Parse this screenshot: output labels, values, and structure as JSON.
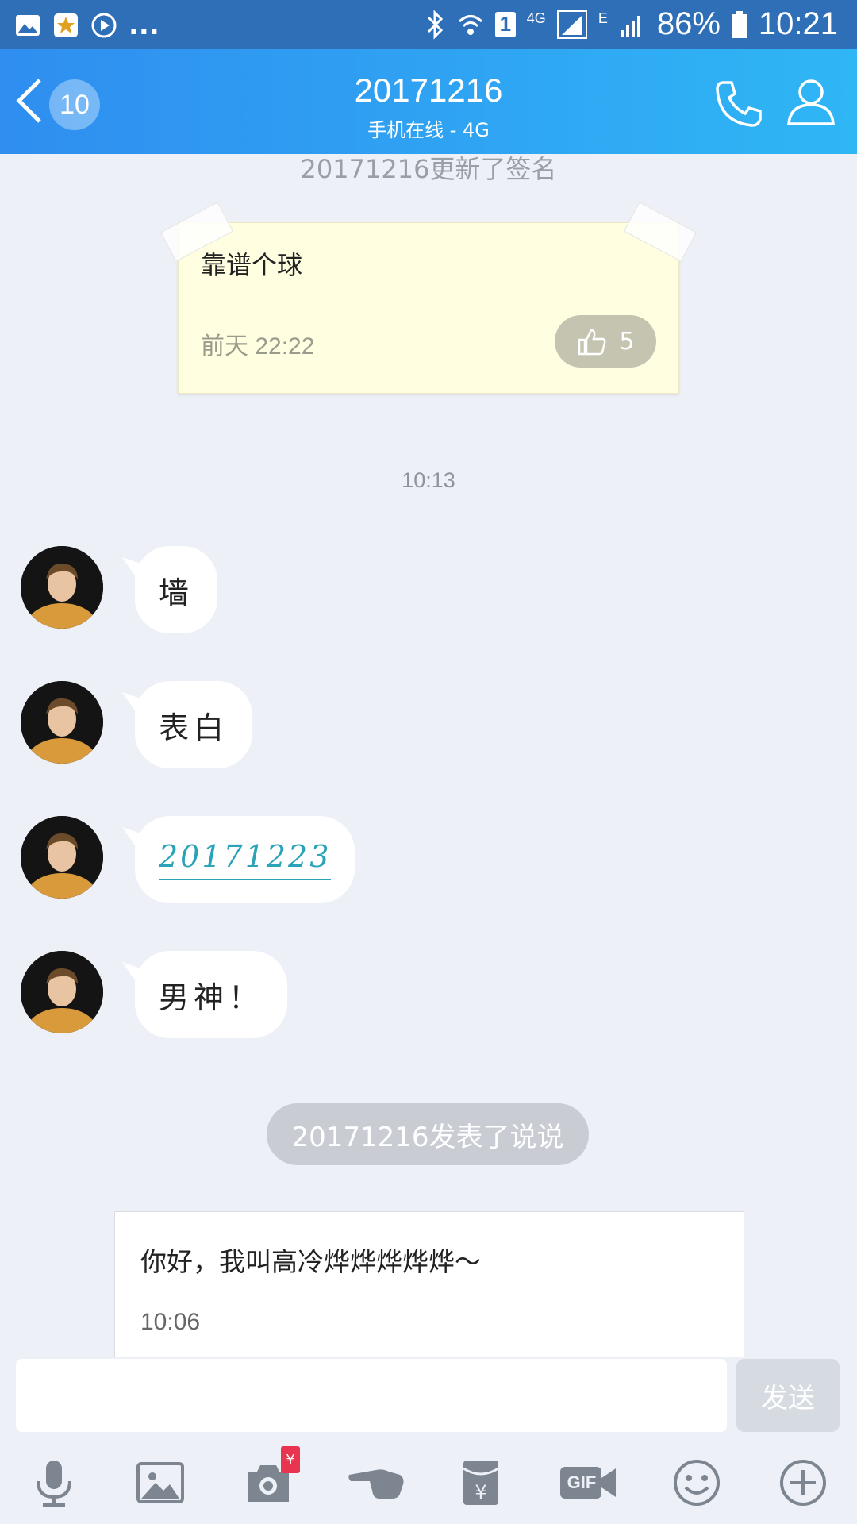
{
  "status_bar": {
    "notification_icons": [
      "gallery-icon",
      "star-app-icon",
      "play-icon"
    ],
    "overflow": "...",
    "sim_badge": "1",
    "network_4g": "4G",
    "network_e": "E",
    "battery": "86%",
    "time": "10:21"
  },
  "header": {
    "unread_count": "10",
    "title": "20171216",
    "subtitle": "手机在线 - 4G"
  },
  "chat": {
    "signature_notice": "20171216更新了签名",
    "signature_card": {
      "text": "靠谱个球",
      "time": "前天 22:22",
      "likes": "5"
    },
    "timestamp": "10:13",
    "messages": [
      {
        "text": "墙"
      },
      {
        "text": "表白"
      },
      {
        "text": "20171223"
      },
      {
        "text": "男神！"
      }
    ],
    "post_notice": "20171216发表了说说",
    "post": {
      "text": "你好，我叫高冷烨烨烨烨烨～",
      "time": "10:06"
    }
  },
  "composer": {
    "input_value": "",
    "send_label": "发送"
  },
  "toolbar": {
    "items": [
      "microphone-icon",
      "image-icon",
      "camera-icon",
      "poke-icon",
      "red-packet-icon",
      "gif-icon",
      "emoji-icon",
      "plus-icon"
    ],
    "camera_badge": "¥",
    "gif_label": "GIF"
  },
  "colors": {
    "status_bar": "#2e6fb8",
    "header_start": "#2f8ef0",
    "header_end": "#2fb6f5",
    "background": "#edf1f7",
    "link": "#2aa3b8",
    "send_disabled": "#d6dbe2"
  }
}
